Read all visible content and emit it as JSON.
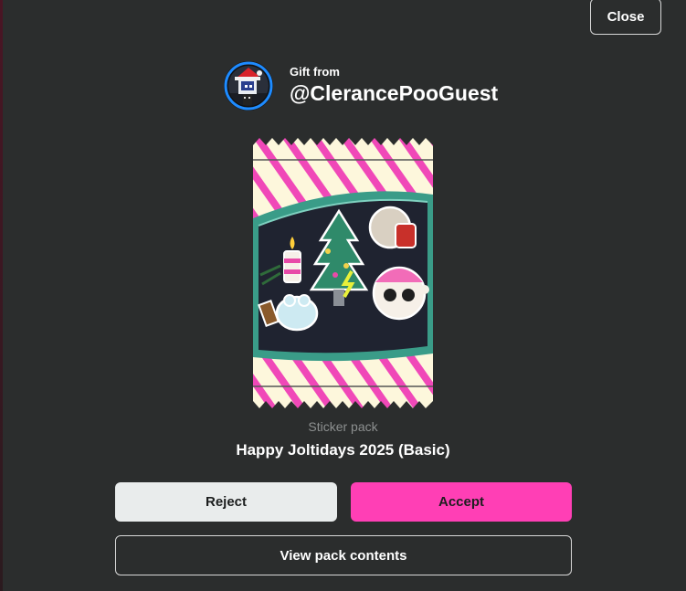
{
  "close_label": "Close",
  "gift": {
    "from_label": "Gift from",
    "username": "@ClerancePooGuest"
  },
  "pack": {
    "type_label": "Sticker pack",
    "name": "Happy Joltidays 2025 (Basic)"
  },
  "actions": {
    "reject_label": "Reject",
    "accept_label": "Accept",
    "view_label": "View pack contents"
  },
  "colors": {
    "background": "#2b2d2d",
    "accent": "#ff3fb5",
    "reject_bg": "#e9ecec",
    "avatar_ring": "#1e8bff",
    "pack_stripe": "#f048b8",
    "pack_base": "#fdf7dc",
    "pack_band": "#3a9c88"
  },
  "icons": {
    "avatar": "avatar-image",
    "pack": "sticker-pack-image"
  }
}
